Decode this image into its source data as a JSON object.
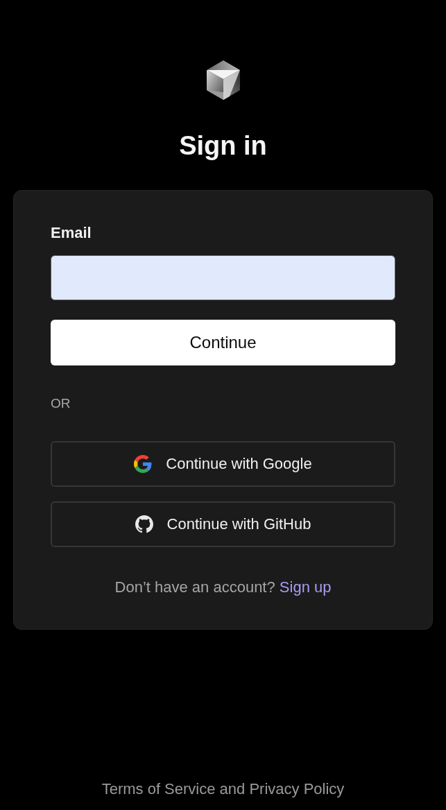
{
  "title": "Sign in",
  "form": {
    "email": {
      "label": "Email"
    },
    "continue_button": "Continue",
    "divider": "OR",
    "providers": [
      {
        "kind": "google",
        "label": "Continue with Google"
      },
      {
        "kind": "github",
        "label": "Continue with GitHub"
      }
    ],
    "signup": {
      "prompt": "Don’t have an account?",
      "link": "Sign up"
    }
  },
  "footer": "Terms of Service and Privacy Policy"
}
